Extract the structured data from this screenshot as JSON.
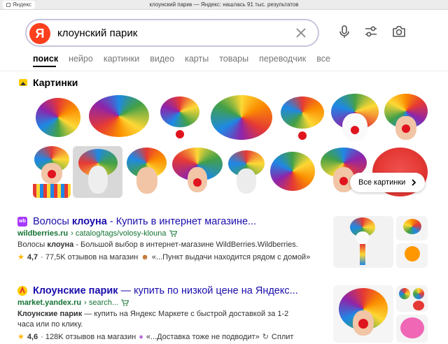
{
  "window": {
    "tab_label": "Яндекс",
    "title": "клоунский парик — Яндекс: нашлась 91 тыс. результатов"
  },
  "search": {
    "logo": "Я",
    "query": "клоунский парик"
  },
  "tabs": [
    "поиск",
    "нейро",
    "картинки",
    "видео",
    "карты",
    "товары",
    "переводчик",
    "все"
  ],
  "images": {
    "heading": "Картинки",
    "all_button": "Все картинки"
  },
  "results": [
    {
      "title_pre": "Волосы ",
      "title_bold": "клоуна",
      "title_post": " - Купить в интернет магазине...",
      "url_host": "wildberries.ru",
      "url_path": "› catalog/tags/volosy-klouna",
      "snippet_pre": "Волосы ",
      "snippet_bold": "клоуна",
      "snippet_post": " - Большой выбор в интернет-магазине WildBerries.Wildberries.",
      "rating": "4,7",
      "reviews": "· 77,5K отзывов на магазин",
      "quote": "«...Пункт выдачи находится рядом с домой»",
      "favicon_text": "wb"
    },
    {
      "title_pre": "",
      "title_bold": "Клоунские парик",
      "title_post": " — купить по низкой цене на Яндекс...",
      "url_host": "market.yandex.ru",
      "url_path": "› search...",
      "snippet_pre": "",
      "snippet_bold": "Клоунские парик",
      "snippet_post": " — купить на Яндекс Маркете с быстрой доставкой за 1-2 часа или по клику.",
      "rating": "4,6",
      "reviews": "· 128K отзывов на магазин",
      "quote": "«...Доставка тоже не подводит»",
      "split": "Сплит"
    }
  ],
  "colors": {
    "accent_red": "#fc3f1d",
    "link": "#1a0dab",
    "url_green": "#137333"
  }
}
